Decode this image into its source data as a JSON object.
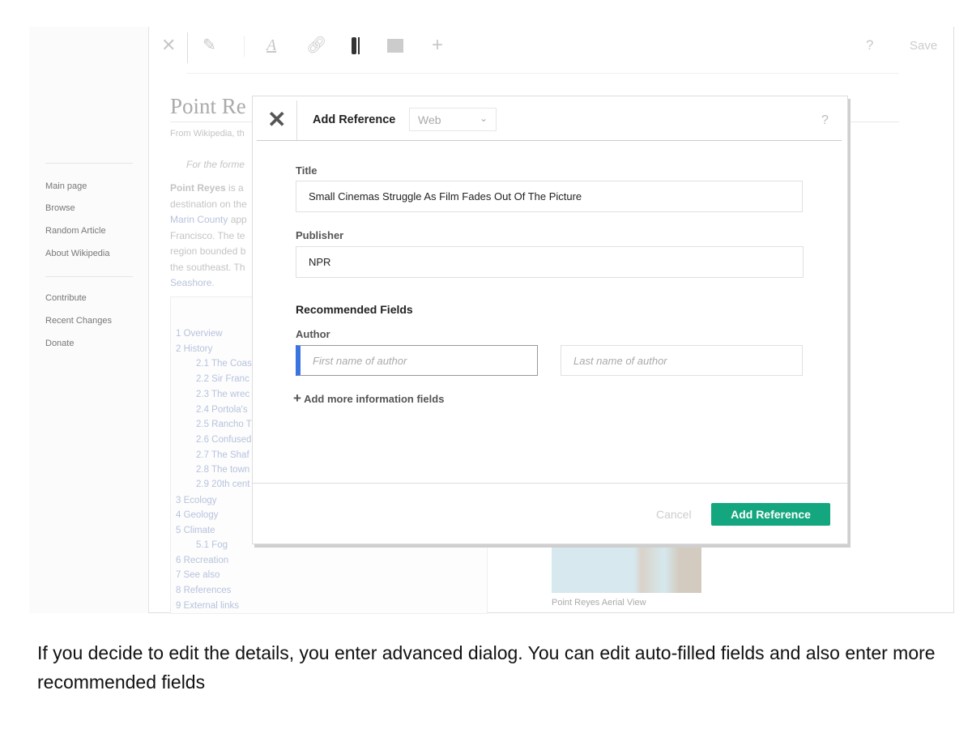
{
  "toolbar": {
    "help": "?",
    "save": "Save",
    "icons": [
      "close-icon",
      "edit-preview-icon",
      "text-style-icon",
      "link-icon",
      "cite-icon",
      "insert-image-icon",
      "insert-plus-icon"
    ]
  },
  "sidebar": {
    "items": [
      "Main page",
      "Browse",
      "Random Article",
      "About Wikipedia"
    ],
    "items2": [
      "Contribute",
      "Recent Changes",
      "Donate"
    ]
  },
  "article": {
    "title": "Point Re",
    "subtitle": "From Wikipedia, th",
    "hatnote": "For the forme",
    "lines": [
      {
        "bold": "Point Reyes",
        "rest": " is a"
      },
      {
        "text": "destination on the"
      },
      {
        "link": "Marin County",
        "rest": " app"
      },
      {
        "text": "Francisco. The te"
      },
      {
        "text": "region bounded b"
      },
      {
        "text": "the southeast. Th"
      },
      {
        "link": "Seashore",
        "rest": "."
      }
    ],
    "toc": [
      {
        "t": "1 Overview",
        "sub": false
      },
      {
        "t": "2 History",
        "sub": false
      },
      {
        "t": "2.1 The Coas",
        "sub": true
      },
      {
        "t": "2.2 Sir Franc",
        "sub": true
      },
      {
        "t": "2.3 The wrec",
        "sub": true
      },
      {
        "t": "2.4 Portola's",
        "sub": true
      },
      {
        "t": "2.5 Rancho T",
        "sub": true
      },
      {
        "t": "2.6 Confused",
        "sub": true
      },
      {
        "t": "2.7 The Shaf",
        "sub": true
      },
      {
        "t": "2.8 The town",
        "sub": true
      },
      {
        "t": "2.9 20th cent",
        "sub": true
      },
      {
        "t": "3 Ecology",
        "sub": false
      },
      {
        "t": "4 Geology",
        "sub": false
      },
      {
        "t": "5 Climate",
        "sub": false
      },
      {
        "t": "5.1 Fog",
        "sub": true
      },
      {
        "t": "6 Recreation",
        "sub": false
      },
      {
        "t": "7 See also",
        "sub": false
      },
      {
        "t": "8 References",
        "sub": false
      },
      {
        "t": "9 External links",
        "sub": false
      }
    ],
    "image_caption": "Point Reyes Aerial View"
  },
  "dialog": {
    "title": "Add Reference",
    "type_select": "Web",
    "help": "?",
    "title_label": "Title",
    "title_value": "Small Cinemas Struggle As Film Fades Out Of The Picture",
    "publisher_label": "Publisher",
    "publisher_value": "NPR",
    "recommended": "Recommended Fields",
    "author_label": "Author",
    "first_placeholder": "First name of author",
    "last_placeholder": "Last name of author",
    "add_more": "Add more information fields",
    "cancel": "Cancel",
    "submit": "Add Reference",
    "colors": {
      "accent": "#14a67e",
      "focus": "#3a74e0"
    }
  },
  "caption": "If you decide to edit the details, you enter advanced dialog. You can edit auto-filled fields and also enter more recommended fields"
}
